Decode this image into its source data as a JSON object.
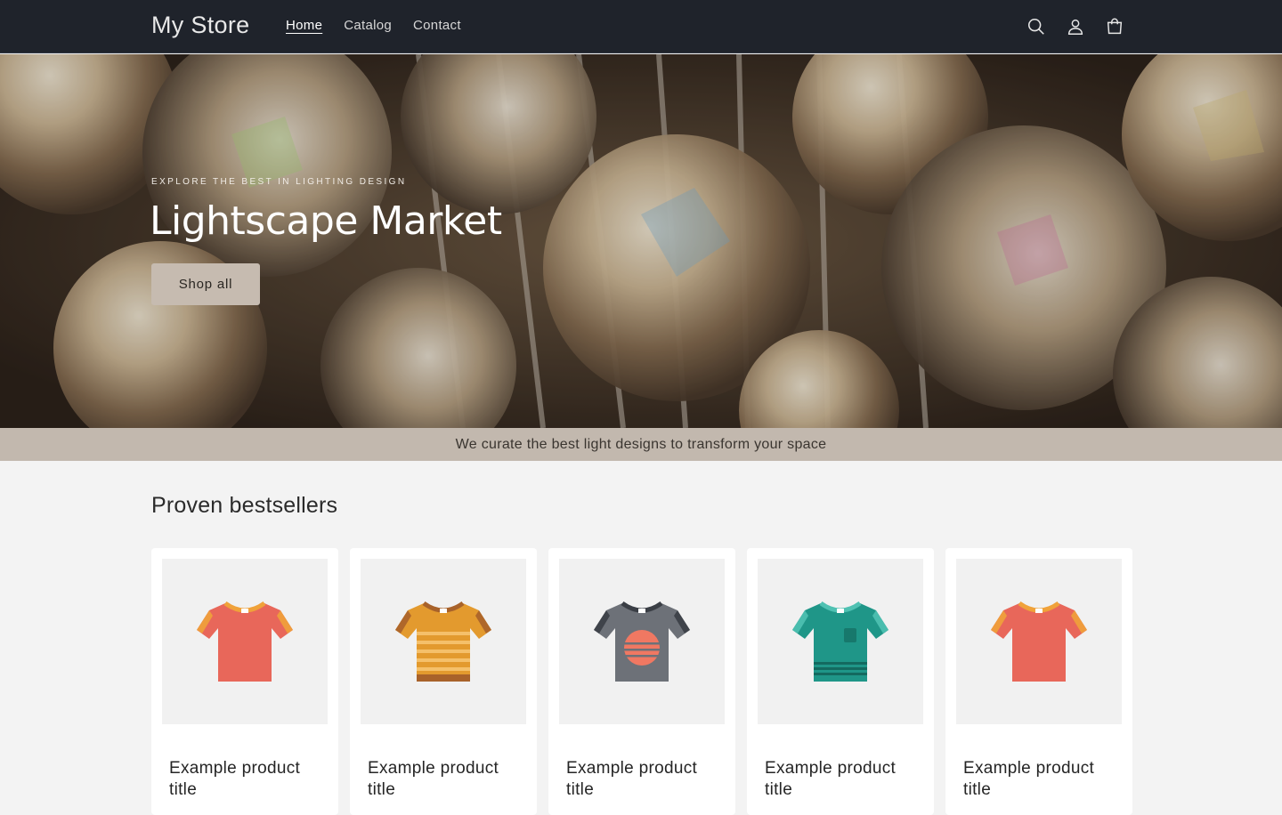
{
  "header": {
    "logo": "My Store",
    "nav": [
      {
        "label": "Home",
        "active": true
      },
      {
        "label": "Catalog",
        "active": false
      },
      {
        "label": "Contact",
        "active": false
      }
    ],
    "icons": [
      "search-icon",
      "account-icon",
      "cart-icon"
    ]
  },
  "hero": {
    "eyebrow": "EXPLORE THE BEST IN LIGHTING DESIGN",
    "title": "Lightscape Market",
    "button_label": "Shop all"
  },
  "announcement": "We curate the best light designs to transform your space",
  "bestsellers": {
    "title": "Proven bestsellers",
    "products": [
      {
        "title": "Example product title",
        "shirt_color": "#e8675a",
        "trim_color": "#f0a23a",
        "style": "plain"
      },
      {
        "title": "Example product title",
        "shirt_color": "#e39a2e",
        "trim_color": "#a8622a",
        "style": "striped"
      },
      {
        "title": "Example product title",
        "shirt_color": "#6d7178",
        "trim_color": "#3a3e45",
        "style": "sunset"
      },
      {
        "title": "Example product title",
        "shirt_color": "#1f9688",
        "trim_color": "#4fc1b2",
        "style": "pocket"
      },
      {
        "title": "Example product title",
        "shirt_color": "#e8675a",
        "trim_color": "#f0a23a",
        "style": "plain"
      }
    ]
  },
  "colors": {
    "header_bg": "#1f232b",
    "announcement_bg": "#c2b8ae",
    "page_bg": "#f3f3f3",
    "button_bg": "#c6bbb0"
  }
}
